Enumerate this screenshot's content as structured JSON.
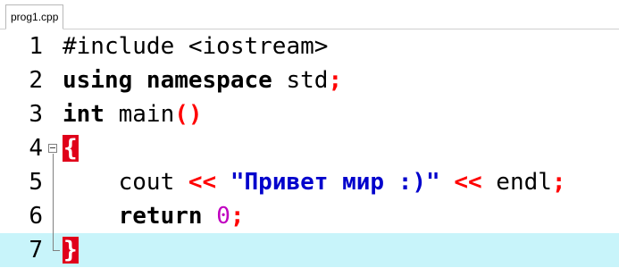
{
  "tab": {
    "label": "prog1.cpp"
  },
  "editor": {
    "lines": [
      {
        "number": "1",
        "segments": [
          {
            "text": "#include <iostream>",
            "type": "plain"
          }
        ]
      },
      {
        "number": "2",
        "segments": [
          {
            "text": "using namespace",
            "type": "kw"
          },
          {
            "text": " std",
            "type": "plain"
          },
          {
            "text": ";",
            "type": "op"
          }
        ]
      },
      {
        "number": "3",
        "segments": [
          {
            "text": "int",
            "type": "kw"
          },
          {
            "text": " main",
            "type": "plain"
          },
          {
            "text": "()",
            "type": "op"
          }
        ]
      },
      {
        "number": "4",
        "segments": [
          {
            "text": "{",
            "type": "brace"
          }
        ]
      },
      {
        "number": "5",
        "segments": [
          {
            "text": "    cout ",
            "type": "plain"
          },
          {
            "text": "<<",
            "type": "op"
          },
          {
            "text": " ",
            "type": "plain"
          },
          {
            "text": "\"Привет мир :)\"",
            "type": "str"
          },
          {
            "text": " ",
            "type": "plain"
          },
          {
            "text": "<<",
            "type": "op"
          },
          {
            "text": " endl",
            "type": "plain"
          },
          {
            "text": ";",
            "type": "op"
          }
        ]
      },
      {
        "number": "6",
        "segments": [
          {
            "text": "    ",
            "type": "plain"
          },
          {
            "text": "return",
            "type": "kw"
          },
          {
            "text": " ",
            "type": "plain"
          },
          {
            "text": "0",
            "type": "num"
          },
          {
            "text": ";",
            "type": "op"
          }
        ]
      },
      {
        "number": "7",
        "segments": [
          {
            "text": "}",
            "type": "brace"
          }
        ]
      }
    ],
    "current_line": 7
  },
  "colors": {
    "current_line_bg": "#c8f4fa",
    "operator": "#ff0000",
    "string": "#0000cc",
    "number": "#c000c0",
    "brace_bg": "#e0001a"
  }
}
